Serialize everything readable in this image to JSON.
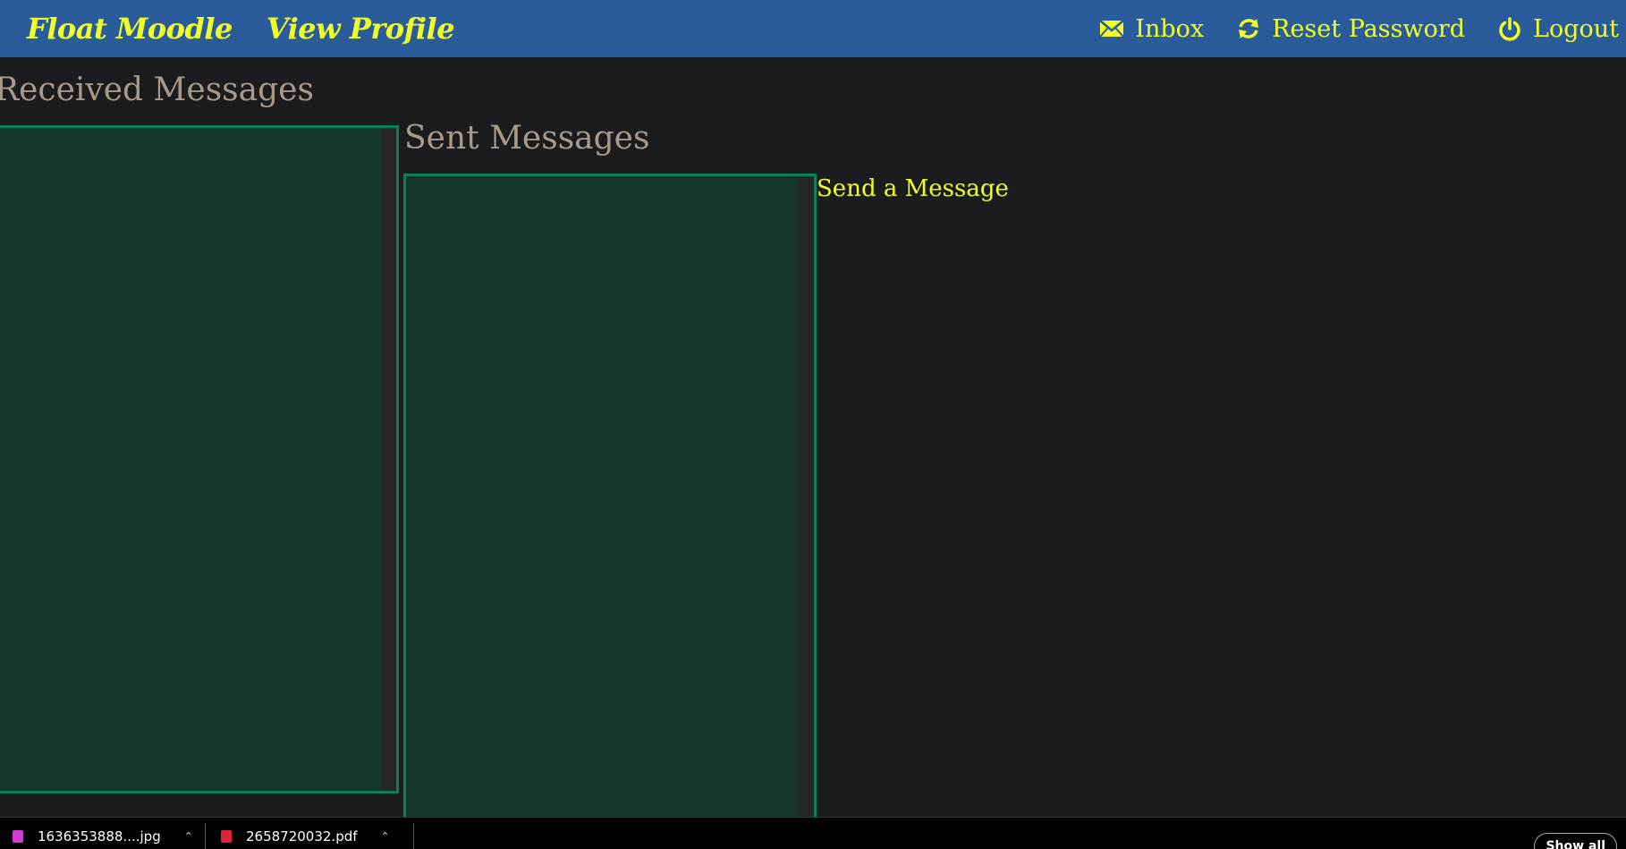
{
  "navbar": {
    "brand": "Float Moodle",
    "profile_link": "View Profile",
    "right_items": [
      {
        "label": "Inbox",
        "icon": "envelope-icon"
      },
      {
        "label": "Reset Password",
        "icon": "refresh-icon"
      },
      {
        "label": "Logout",
        "icon": "power-icon"
      }
    ],
    "colors": {
      "background": "#2a5b9a",
      "link": "#f0ff2a"
    }
  },
  "main": {
    "received_title": "Received Messages",
    "sent_title": "Sent Messages",
    "send_link": "Send a Message",
    "colors": {
      "page_background": "#1b1c1e",
      "panel_background": "#13352a",
      "panel_border": "#0d7f5d",
      "heading": "#a89a8a"
    }
  },
  "download_bar": {
    "items": [
      {
        "filename": "1636353888....jpg",
        "icon": "image-file-icon",
        "icon_color": "#d23bd2"
      },
      {
        "filename": "2658720032.pdf",
        "icon": "pdf-file-icon",
        "icon_color": "#e0243c"
      }
    ],
    "show_all_label": "Show all"
  }
}
